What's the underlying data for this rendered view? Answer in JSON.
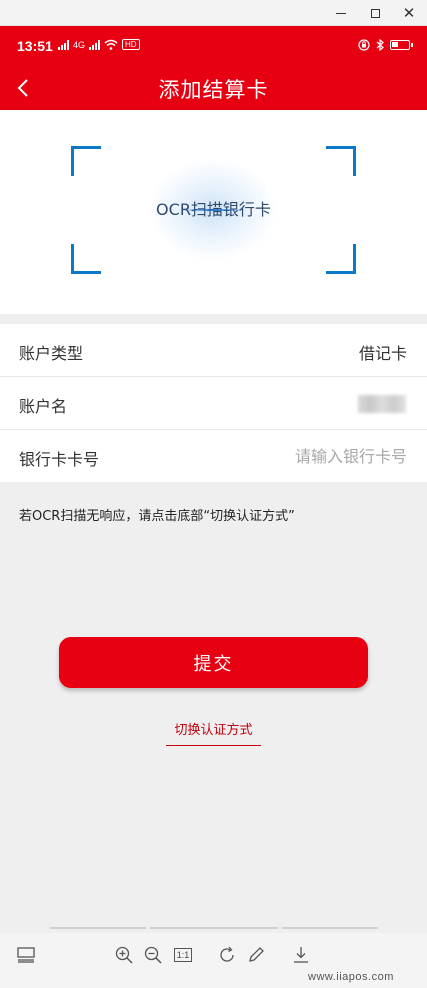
{
  "status_bar": {
    "time": "13:51",
    "network_label": "4G",
    "hd_label": "HD",
    "icons": [
      "signal-icon",
      "wifi-icon",
      "location-icon",
      "bluetooth-icon",
      "battery-icon"
    ]
  },
  "header": {
    "title": "添加结算卡",
    "back_icon": "chevron-left-icon",
    "background_color": "#e60012"
  },
  "scanner": {
    "label": "OCR扫描银行卡",
    "frame_color": "#0b78c8"
  },
  "form": {
    "account_type": {
      "label": "账户类型",
      "value": "借记卡"
    },
    "account_name": {
      "label": "账户名",
      "value_obscured": true
    },
    "card_number": {
      "label": "银行卡卡号",
      "placeholder": "请输入银行卡号",
      "value": ""
    }
  },
  "hint": "若OCR扫描无响应，请点击底部“切换认证方式”",
  "actions": {
    "submit_label": "提交",
    "switch_label": "切换认证方式"
  },
  "toolbar": {
    "icons": [
      "layout-icon",
      "zoom-in-icon",
      "zoom-out-icon",
      "actual-size-icon",
      "rotate-icon",
      "edit-icon",
      "download-icon"
    ],
    "actual_size_label": "1:1"
  },
  "watermark": "www.iiapos.com"
}
